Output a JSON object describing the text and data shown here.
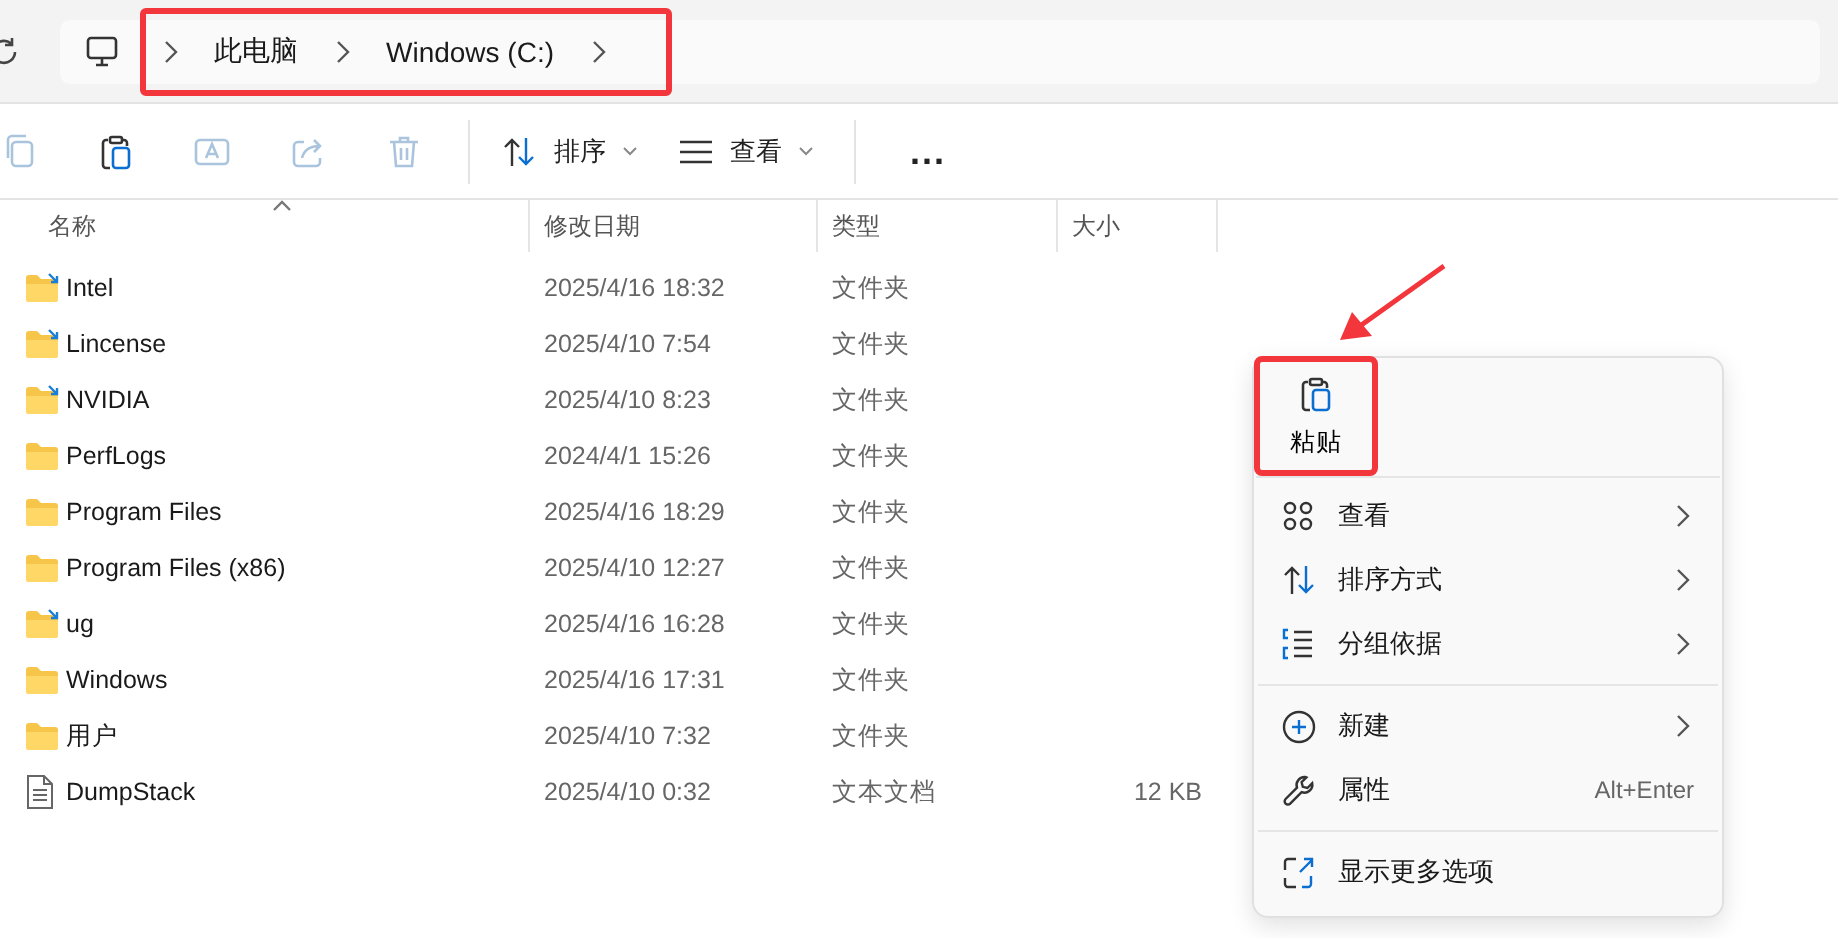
{
  "address_bar": {
    "segments": [
      {
        "label": "此电脑"
      },
      {
        "label": "Windows (C:)"
      }
    ],
    "highlighted": true
  },
  "toolbar": {
    "icon_buttons": [
      {
        "kind": "copy",
        "disabled": true
      },
      {
        "kind": "paste",
        "disabled": false
      },
      {
        "kind": "rename",
        "disabled": true
      },
      {
        "kind": "share",
        "disabled": true
      },
      {
        "kind": "delete",
        "disabled": true
      }
    ],
    "sort_button": {
      "label": "排序"
    },
    "view_button": {
      "label": "查看"
    },
    "more_button": {
      "label": "..."
    }
  },
  "table": {
    "columns": [
      {
        "label": "名称",
        "sorted": true
      },
      {
        "label": "修改日期",
        "sorted": false
      },
      {
        "label": "类型",
        "sorted": false
      },
      {
        "label": "大小",
        "sorted": false
      }
    ],
    "rows": [
      {
        "kind": "folder",
        "name": "Intel",
        "date": "2025/4/16 18:32",
        "type": "文件夹",
        "linked": true
      },
      {
        "kind": "folder",
        "name": "Lincense",
        "date": "2025/4/10 7:54",
        "type": "文件夹",
        "linked": true
      },
      {
        "kind": "folder",
        "name": "NVIDIA",
        "date": "2025/4/10 8:23",
        "type": "文件夹",
        "linked": true
      },
      {
        "kind": "folder",
        "name": "PerfLogs",
        "date": "2024/4/1 15:26",
        "type": "文件夹",
        "linked": false
      },
      {
        "kind": "folder",
        "name": "Program Files",
        "date": "2025/4/16 18:29",
        "type": "文件夹",
        "linked": false
      },
      {
        "kind": "folder",
        "name": "Program Files (x86)",
        "date": "2025/4/10 12:27",
        "type": "文件夹",
        "linked": false
      },
      {
        "kind": "folder",
        "name": "ug",
        "date": "2025/4/16 16:28",
        "type": "文件夹",
        "linked": true
      },
      {
        "kind": "folder",
        "name": "Windows",
        "date": "2025/4/16 17:31",
        "type": "文件夹",
        "linked": false
      },
      {
        "kind": "folder",
        "name": "用户",
        "date": "2025/4/10 7:32",
        "type": "文件夹",
        "linked": false
      },
      {
        "kind": "file",
        "name": "DumpStack",
        "date": "2025/4/10 0:32",
        "type": "文本文档",
        "size": "12 KB"
      }
    ]
  },
  "context_menu": {
    "paste_button": {
      "label": "粘贴",
      "highlighted": true,
      "pointer_arrow": true
    },
    "groups": [
      [
        {
          "kind": "view",
          "label": "查看",
          "submenu": true
        },
        {
          "kind": "sort",
          "label": "排序方式",
          "submenu": true
        },
        {
          "kind": "group",
          "label": "分组依据",
          "submenu": true
        }
      ],
      [
        {
          "kind": "new",
          "label": "新建",
          "submenu": true
        },
        {
          "kind": "properties",
          "label": "属性",
          "submenu": false,
          "shortcut": "Alt+Enter"
        }
      ],
      [
        {
          "kind": "more",
          "label": "显示更多选项",
          "submenu": false
        }
      ]
    ]
  }
}
